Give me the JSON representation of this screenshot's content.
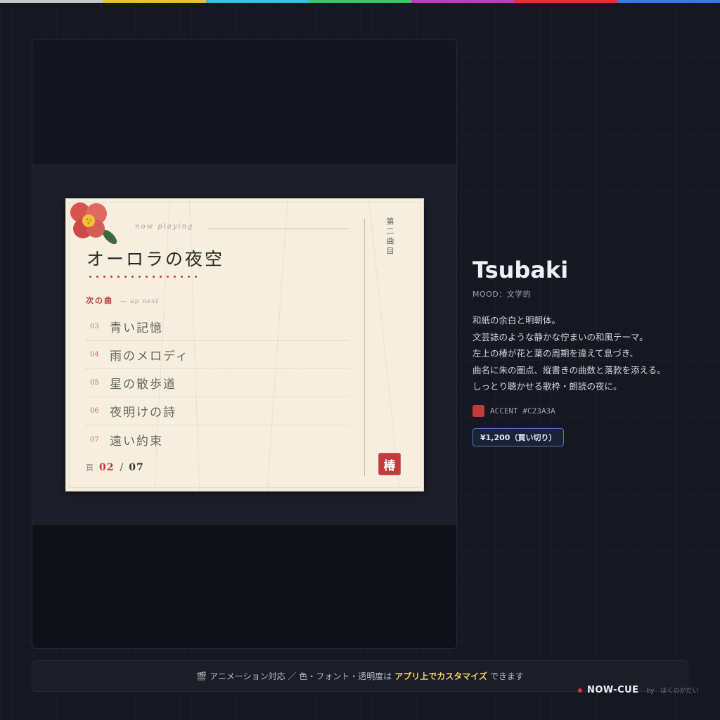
{
  "top_stripe": {
    "colors": [
      "#c8c8c8",
      "#e8c232",
      "#2fc6e0",
      "#36c86a",
      "#c43ac8",
      "#e8303a",
      "#3a7ae8"
    ]
  },
  "card": {
    "now_playing": "now playing",
    "song_title": "オーロラの夜空",
    "next_label": "次の曲",
    "next_label_en": "— up next",
    "tracks": [
      {
        "num": "03",
        "title": "青い記憶"
      },
      {
        "num": "04",
        "title": "雨のメロディ"
      },
      {
        "num": "05",
        "title": "星の散歩道"
      },
      {
        "num": "06",
        "title": "夜明けの詩"
      },
      {
        "num": "07",
        "title": "遠い約束"
      }
    ],
    "page_label": "頁",
    "page_current": "02",
    "page_sep": "/",
    "page_total": "07",
    "track_index": "第二曲目",
    "seal": "椿",
    "accent_color": "#c23a3a"
  },
  "theme": {
    "name": "Tsubaki",
    "mood": "MOOD：文学的",
    "description": [
      "和紙の余白と明朝体。",
      "文芸誌のような静かな佇まいの和風テーマ。",
      "左上の椿が花と葉の周期を違えて息づき、",
      "曲名に朱の圏点、縦書きの曲数と落款を添える。",
      "しっとり聴かせる歌枠・朗読の夜に。"
    ],
    "accent_label": "ACCENT #C23A3A",
    "accent_color": "#C23A3A",
    "price": "¥1,200（買い切り）"
  },
  "footer": {
    "icon": "clapper-icon",
    "text_before": "アニメーション対応 ／ 色・フォント・透明度は",
    "text_highlight": "アプリ上でカスタマイズ",
    "text_after": "できます"
  },
  "brand": {
    "name": "NOW-CUE",
    "by": "by　ぼくのかだい"
  }
}
